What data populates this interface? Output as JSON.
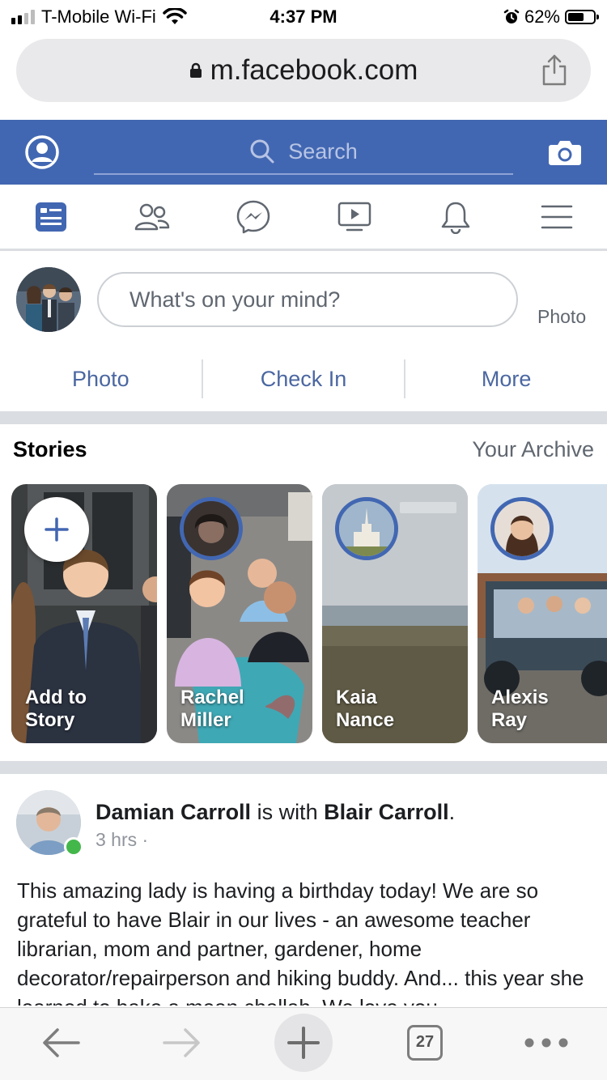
{
  "status_bar": {
    "carrier": "T-Mobile Wi-Fi",
    "time": "4:37 PM",
    "battery": "62%",
    "battery_level": 0.62
  },
  "browser": {
    "url": "m.facebook.com",
    "tab_count": "27"
  },
  "fb_header": {
    "search_placeholder": "Search"
  },
  "composer": {
    "placeholder": "What's on your mind?",
    "side_label": "Photo",
    "actions": [
      "Photo",
      "Check In",
      "More"
    ]
  },
  "stories": {
    "title": "Stories",
    "archive_link": "Your Archive",
    "items": [
      {
        "name": "Add to Story",
        "line1": "Add to",
        "line2": "Story"
      },
      {
        "name": "Rachel Miller",
        "line1": "Rachel",
        "line2": "Miller"
      },
      {
        "name": "Kaia Nance",
        "line1": "Kaia",
        "line2": "Nance"
      },
      {
        "name": "Alexis Ray",
        "line1": "Alexis",
        "line2": "Ray"
      }
    ]
  },
  "post": {
    "author": "Damian Carroll",
    "with_text": " is with ",
    "tagged": "Blair Carroll",
    "suffix": ".",
    "time": "3 hrs ·",
    "body": "This amazing lady is having a birthday today! We are so grateful to have Blair in our lives - an awesome teacher librarian, mom and partner, gardener, home decorator/repairperson and hiking buddy. And... this year she learned to bake a mean challah. We love you"
  },
  "colors": {
    "fb_blue": "#4267b2",
    "link_blue": "#4b67a1",
    "online_green": "#44b74a"
  }
}
